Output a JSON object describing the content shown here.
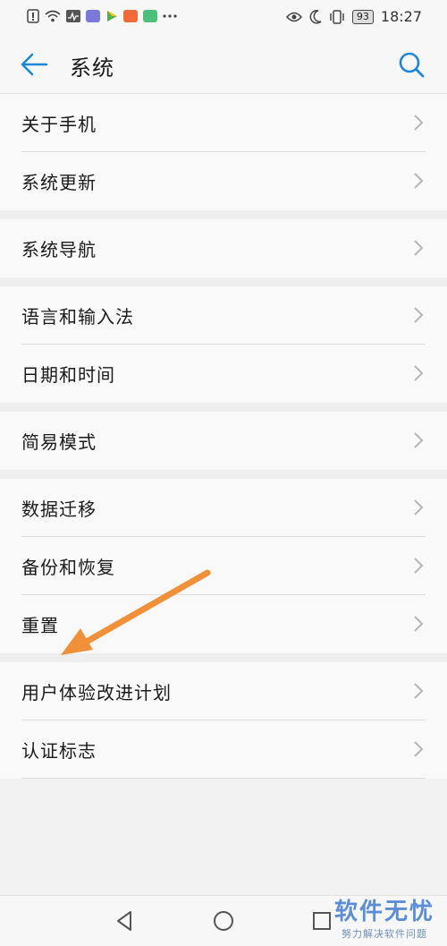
{
  "status_bar": {
    "battery": "93",
    "time": "18:27",
    "left_icons": [
      "alert-icon",
      "wifi-icon",
      "activity-icon",
      "app-icon-1",
      "play-icon",
      "app-icon-2",
      "app-icon-3",
      "more-icon"
    ],
    "right_icons": [
      "eye-icon",
      "moon-icon",
      "vibrate-icon"
    ]
  },
  "header": {
    "title": "系统",
    "back_icon": "back-arrow-icon",
    "search_icon": "search-icon",
    "accent_color": "#1e88d8"
  },
  "groups": [
    {
      "items": [
        {
          "label": "关于手机"
        },
        {
          "label": "系统更新"
        }
      ]
    },
    {
      "items": [
        {
          "label": "系统导航"
        }
      ]
    },
    {
      "items": [
        {
          "label": "语言和输入法"
        },
        {
          "label": "日期和时间"
        }
      ]
    },
    {
      "items": [
        {
          "label": "简易模式"
        }
      ]
    },
    {
      "items": [
        {
          "label": "数据迁移"
        },
        {
          "label": "备份和恢复"
        },
        {
          "label": "重置"
        }
      ]
    },
    {
      "items": [
        {
          "label": "用户体验改进计划"
        },
        {
          "label": "认证标志"
        }
      ]
    }
  ],
  "nav_bar": {
    "back": "triangle-back-icon",
    "home": "circle-home-icon",
    "recent": "square-recent-icon"
  },
  "watermark": {
    "main": "软件无忧",
    "sub": "努力解决软件问题"
  },
  "annotation": {
    "color": "#f0913a",
    "points_to": "重置"
  }
}
